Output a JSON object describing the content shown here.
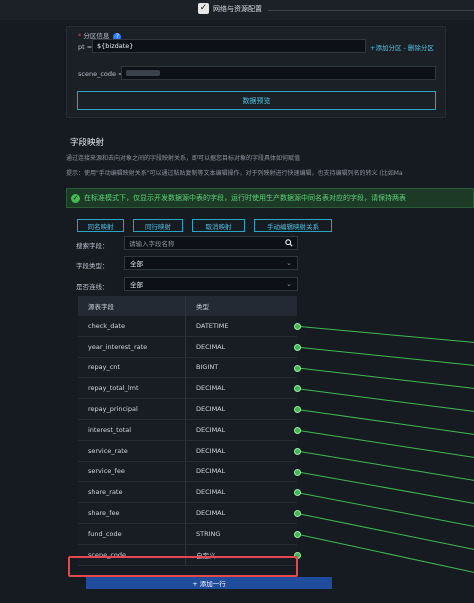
{
  "header": {
    "checkbox_mark": "✓",
    "title": "网络与资源配置"
  },
  "partition": {
    "label": "分区信息",
    "help": "?",
    "key": "pt =",
    "value": "${bizdate}",
    "links": "+添加分区 - 删除分区"
  },
  "scene_code_field": {
    "label": "scene_code =",
    "value": ""
  },
  "preview_button": "数据预览",
  "mapping": {
    "title": "字段映射",
    "desc1": "通过连接来源和去向对象之间的字段映射关系，即可以据您目标对象的字段具体如何赋值",
    "desc2": "提示：使用\"手动编辑映射关系\"可以通过粘贴复制等文本编辑操作，对于列映射进行快速编辑，也支持编辑列名的转义 (比如Ma",
    "banner": "在标准模式下，仅显示开发数据源中表的字段，运行时使用生产数据源中同名表对应的字段，请保持两表",
    "banner_icon": "✓",
    "buttons": [
      "同名映射",
      "同行映射",
      "取消映射",
      "手动编辑映射关系"
    ]
  },
  "filters": {
    "search_label": "搜索字段：",
    "search_placeholder": "请输入字段名称",
    "type_label": "字段类型：",
    "type_value": "全部",
    "connected_label": "是否连线：",
    "connected_value": "全部"
  },
  "table": {
    "headers": [
      "源表字段",
      "类型"
    ],
    "rows": [
      {
        "name": "check_date",
        "type": "DATETIME"
      },
      {
        "name": "year_interest_rate",
        "type": "DECIMAL"
      },
      {
        "name": "repay_cnt",
        "type": "BIGINT"
      },
      {
        "name": "repay_total_lmt",
        "type": "DECIMAL"
      },
      {
        "name": "repay_principal",
        "type": "DECIMAL"
      },
      {
        "name": "interest_total",
        "type": "DECIMAL"
      },
      {
        "name": "service_rate",
        "type": "DECIMAL"
      },
      {
        "name": "service_fee",
        "type": "DECIMAL"
      },
      {
        "name": "share_rate",
        "type": "DECIMAL"
      },
      {
        "name": "share_fee",
        "type": "DECIMAL"
      },
      {
        "name": "fund_code",
        "type": "STRING"
      },
      {
        "name": "scene_code",
        "type": "自定义"
      }
    ],
    "add_row": "+ 添加一行"
  },
  "colors": {
    "accent": "#4fc3e0",
    "connector": "#3fb950",
    "highlight": "#e5484d"
  }
}
